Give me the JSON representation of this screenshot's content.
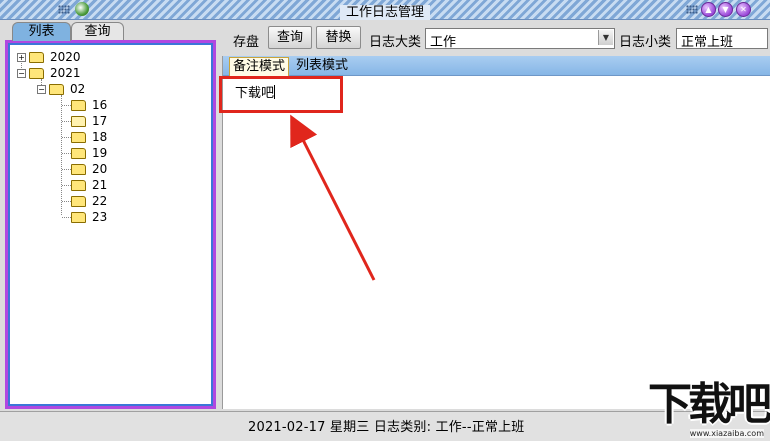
{
  "window": {
    "title": "工作日志管理"
  },
  "left_tabs": [
    "列表",
    "查询"
  ],
  "tree": {
    "years": [
      "2020",
      "2021"
    ],
    "month": "02",
    "days": [
      "16",
      "17",
      "18",
      "19",
      "20",
      "21",
      "22",
      "23"
    ]
  },
  "toolbar": {
    "save": "存盘",
    "query": "查询",
    "replace": "替换",
    "category_label": "日志大类",
    "category_value": "工作",
    "subcategory_label": "日志小类",
    "subcategory_value": "正常上班"
  },
  "modes": {
    "memo": "备注模式",
    "list": "列表模式"
  },
  "editor": {
    "text": "下载吧"
  },
  "status": "2021-02-17  星期三  日志类别: 工作--正常上班",
  "watermark": {
    "logo": "下载吧",
    "url": "www.xiazaiba.com"
  },
  "colors": {
    "highlight": "#e0261c",
    "panel_border": "#b048e0",
    "tab_active": "#7fb2e0"
  }
}
